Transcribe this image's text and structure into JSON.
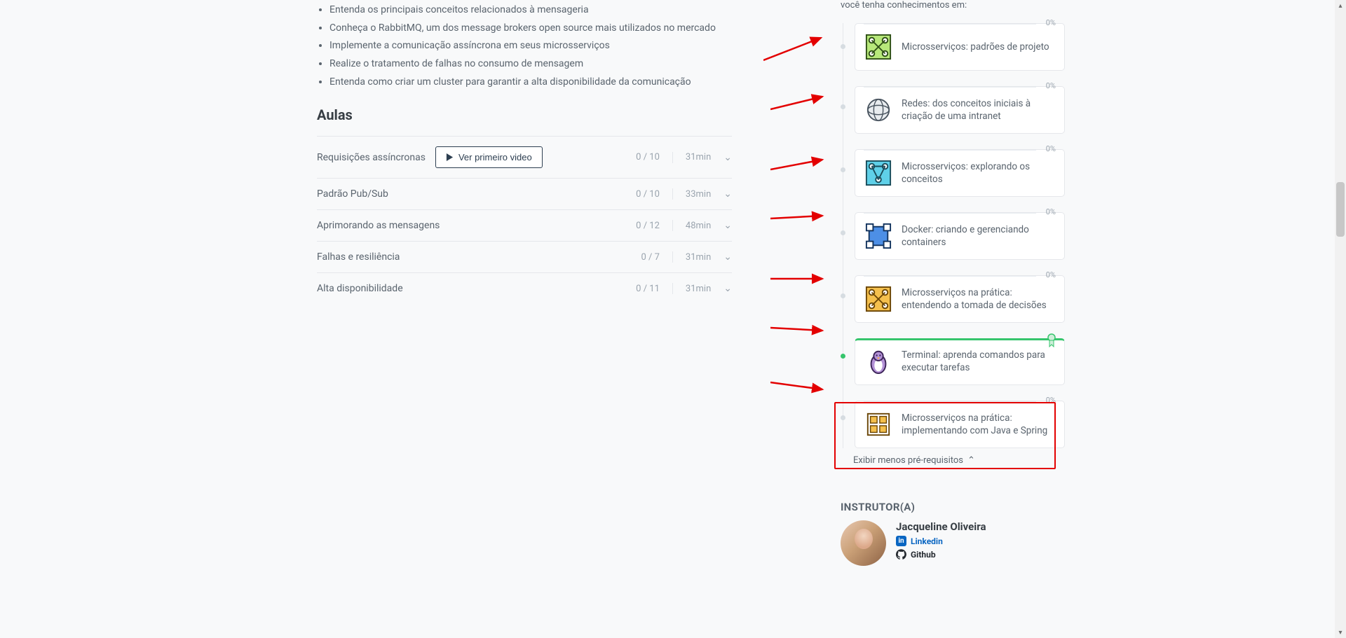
{
  "bullets": [
    "Entenda os principais conceitos relacionados à mensageria",
    "Conheça o RabbitMQ, um dos message brokers open source mais utilizados no mercado",
    "Implemente a comunicação assíncrona em seus microsserviços",
    "Realize o tratamento de falhas no consumo de mensagem",
    "Entenda como criar um cluster para garantir a alta disponibilidade da comunicação"
  ],
  "lessons_heading": "Aulas",
  "first_video_btn": "Ver primeiro video",
  "lessons": [
    {
      "title": "Requisições assíncronas",
      "count": "0 / 10",
      "duration": "31min",
      "has_button": true
    },
    {
      "title": "Padrão Pub/Sub",
      "count": "0 / 10",
      "duration": "33min",
      "has_button": false
    },
    {
      "title": "Aprimorando as mensagens",
      "count": "0 / 12",
      "duration": "48min",
      "has_button": false
    },
    {
      "title": "Falhas e resiliência",
      "count": "0 / 7",
      "duration": "31min",
      "has_button": false
    },
    {
      "title": "Alta disponibilidade",
      "count": "0 / 11",
      "duration": "31min",
      "has_button": false
    }
  ],
  "sidebar_intro": "você tenha conhecimentos em:",
  "prereqs": [
    {
      "title": "Microsserviços: padrões de projeto",
      "pct": "0%",
      "icon": "mesh-green"
    },
    {
      "title": "Redes: dos conceitos iniciais à criação de uma intranet",
      "pct": "0%",
      "icon": "globe"
    },
    {
      "title": "Microsserviços: explorando os conceitos",
      "pct": "0%",
      "icon": "mesh-teal"
    },
    {
      "title": "Docker: criando e gerenciando containers",
      "pct": "0%",
      "icon": "container-blue"
    },
    {
      "title": "Microsserviços na prática: entendendo a tomada de decisões",
      "pct": "0%",
      "icon": "mesh-amber"
    },
    {
      "title": "Terminal: aprenda comandos para executar tarefas",
      "pct": "",
      "icon": "penguin",
      "completed": true
    },
    {
      "title": "Microsserviços na prática: implementando com Java e Spring",
      "pct": "0%",
      "icon": "tiles-amber"
    }
  ],
  "show_less": "Exibir menos pré-requisitos",
  "instructor_heading": "INSTRUTOR(A)",
  "instructor": {
    "name": "Jacqueline Oliveira",
    "linkedin": "Linkedin",
    "github": "Github"
  }
}
